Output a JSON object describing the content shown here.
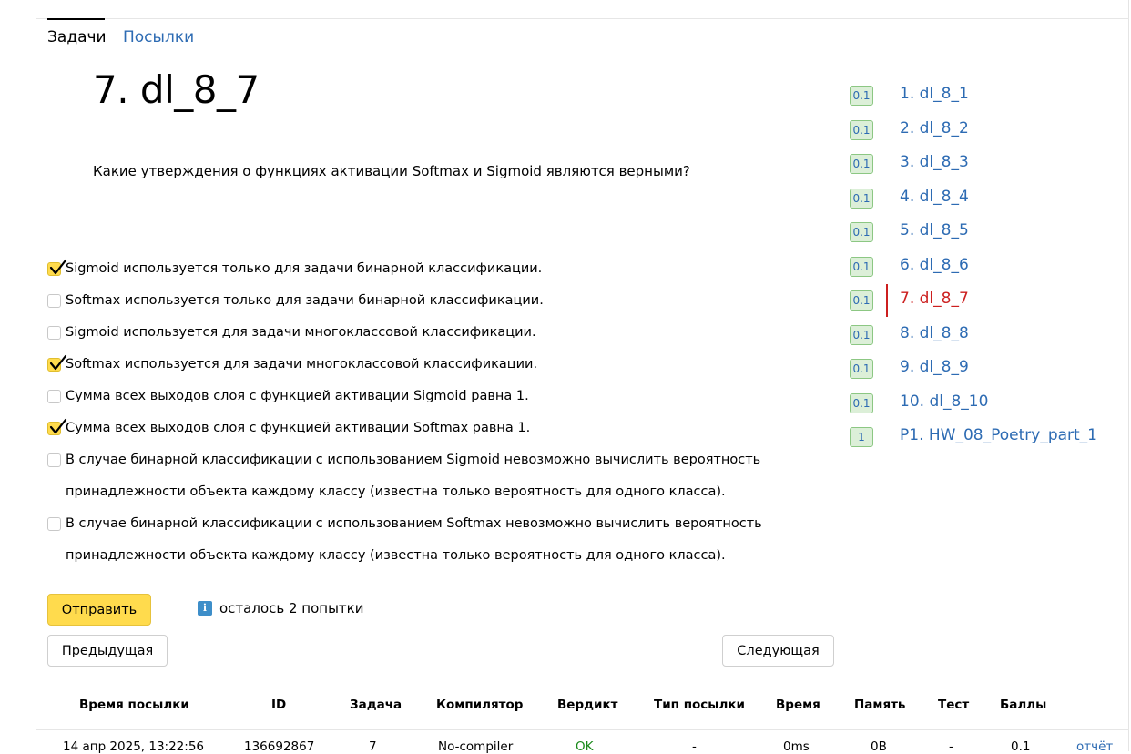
{
  "tabs": {
    "tasks": "Задачи",
    "submissions": "Посылки"
  },
  "problem": {
    "title": "7. dl_8_7",
    "question": "Какие утверждения о функциях активации Softmax и Sigmoid являются верными?"
  },
  "options": [
    {
      "lines": [
        "Sigmoid используется только для задачи бинарной классификации."
      ],
      "checked": true
    },
    {
      "lines": [
        "Softmax используется только для задачи бинарной классификации."
      ],
      "checked": false
    },
    {
      "lines": [
        "Sigmoid используется для задачи многоклассовой классификации."
      ],
      "checked": false
    },
    {
      "lines": [
        "Softmax используется для задачи многоклассовой классификации."
      ],
      "checked": true
    },
    {
      "lines": [
        "Сумма всех выходов слоя с функцией активации Sigmoid равна 1."
      ],
      "checked": false
    },
    {
      "lines": [
        "Сумма всех выходов слоя с функцией активации Softmax равна 1."
      ],
      "checked": true
    },
    {
      "lines": [
        "В случае бинарной классификации с использованием Sigmoid невозможно вычислить вероятность",
        "принадлежности объекта каждому классу (известна только вероятность для одного класса)."
      ],
      "checked": false
    },
    {
      "lines": [
        "В случае бинарной классификации с использованием Softmax невозможно вычислить вероятность",
        "принадлежности объекта каждому классу (известна только вероятность для одного класса)."
      ],
      "checked": false
    }
  ],
  "actions": {
    "submit": "Отправить",
    "info_icon": "i",
    "attempts_left": "осталось 2 попытки",
    "previous": "Предыдущая",
    "next": "Следующая"
  },
  "task_list": [
    {
      "score": "0.1",
      "label": "1. dl_8_1",
      "current": false
    },
    {
      "score": "0.1",
      "label": "2. dl_8_2",
      "current": false
    },
    {
      "score": "0.1",
      "label": "3. dl_8_3",
      "current": false
    },
    {
      "score": "0.1",
      "label": "4. dl_8_4",
      "current": false
    },
    {
      "score": "0.1",
      "label": "5. dl_8_5",
      "current": false
    },
    {
      "score": "0.1",
      "label": "6. dl_8_6",
      "current": false
    },
    {
      "score": "0.1",
      "label": "7. dl_8_7",
      "current": true
    },
    {
      "score": "0.1",
      "label": "8. dl_8_8",
      "current": false
    },
    {
      "score": "0.1",
      "label": "9. dl_8_9",
      "current": false
    },
    {
      "score": "0.1",
      "label": "10. dl_8_10",
      "current": false
    },
    {
      "score": "1",
      "label": "P1. HW_08_Poetry_part_1",
      "current": false
    }
  ],
  "submissions_table": {
    "headers": {
      "time": "Время посылки",
      "id": "ID",
      "task": "Задача",
      "compiler": "Компилятор",
      "verdict": "Вердикт",
      "type": "Тип посылки",
      "duration": "Время",
      "memory": "Память",
      "test": "Тест",
      "score": "Баллы"
    },
    "row": {
      "time": "14 апр 2025, 13:22:56",
      "id": "136692867",
      "task": "7",
      "compiler": "No-compiler",
      "verdict": "OK",
      "type": "-",
      "duration": "0ms",
      "memory": "0B",
      "test": "-",
      "score": "0.1",
      "report": "отчёт"
    }
  },
  "colors": {
    "accent_yellow": "#ffdb4d",
    "link_blue": "#2d6bb3",
    "current_red": "#cc1f1f",
    "ok_green": "#1a8a1a"
  }
}
